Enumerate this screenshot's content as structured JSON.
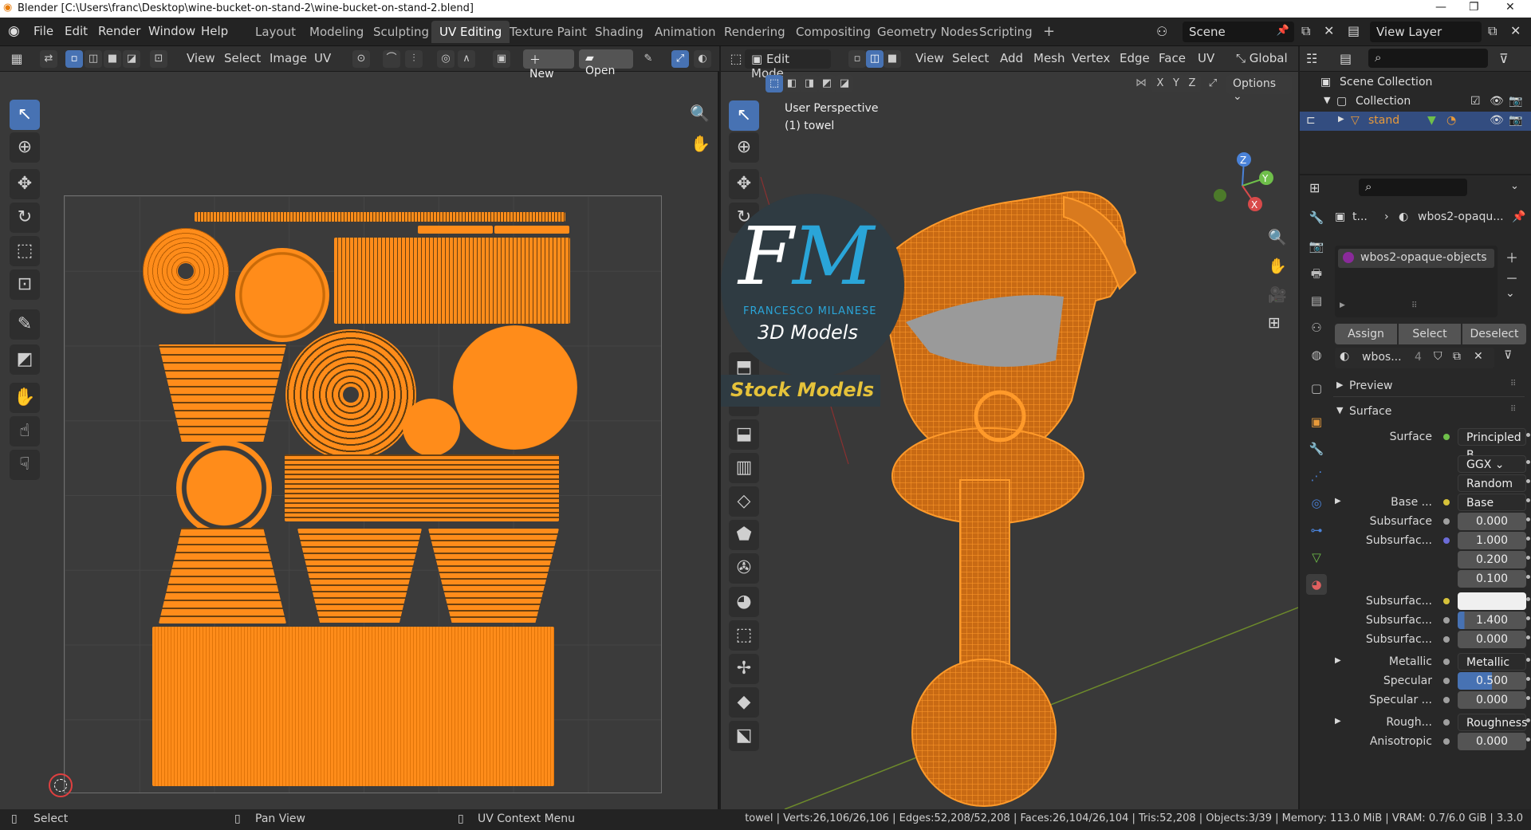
{
  "window": {
    "title": "Blender [C:\\Users\\franc\\Desktop\\wine-bucket-on-stand-2\\wine-bucket-on-stand-2.blend]",
    "minimize": "—",
    "maximize": "❐",
    "close": "✕"
  },
  "menus": [
    "File",
    "Edit",
    "Render",
    "Window",
    "Help"
  ],
  "workspaces": [
    {
      "label": "Layout"
    },
    {
      "label": "Modeling"
    },
    {
      "label": "Sculpting"
    },
    {
      "label": "UV Editing",
      "active": true
    },
    {
      "label": "Texture Paint"
    },
    {
      "label": "Shading"
    },
    {
      "label": "Animation"
    },
    {
      "label": "Rendering"
    },
    {
      "label": "Compositing"
    },
    {
      "label": "Geometry Nodes"
    },
    {
      "label": "Scripting"
    }
  ],
  "add_workspace": "+",
  "scene": {
    "value": "Scene"
  },
  "view_layer": {
    "value": "View Layer"
  },
  "uv_header": {
    "view": "View",
    "select": "Select",
    "image": "Image",
    "uv": "UV",
    "new": "New",
    "open": "Open"
  },
  "viewport_header": {
    "mode": "Edit Mode",
    "view": "View",
    "select": "Select",
    "add": "Add",
    "mesh": "Mesh",
    "vertex": "Vertex",
    "edge": "Edge",
    "face": "Face",
    "uv": "UV",
    "orientation": "Global",
    "options": "Options",
    "x": "X",
    "y": "Y",
    "z": "Z"
  },
  "viewport_overlay": {
    "perspective": "User Perspective",
    "object": "(1) towel"
  },
  "watermark": {
    "letters_f": "F",
    "letters_m": "M",
    "name": "FRANCESCO MILANESE",
    "sub": "3D Models",
    "banner": "Stock Models"
  },
  "gizmo": {
    "x": "X",
    "y": "Y",
    "z": "Z"
  },
  "outliner": {
    "search_placeholder": "",
    "root": "Scene Collection",
    "collection": "Collection",
    "object": "stand"
  },
  "properties": {
    "breadcrumb_obj": "t...",
    "breadcrumb_mat": "wbos2-opaqu...",
    "slot": "wbos2-opaque-objects",
    "assign": "Assign",
    "select": "Select",
    "deselect": "Deselect",
    "material_name": "wbos...",
    "users": "4",
    "preview": "Preview",
    "surface_panel": "Surface",
    "rows": [
      {
        "label": "Surface",
        "value": "Principled B...",
        "dot": "#6fbf4a",
        "style": "dark"
      },
      {
        "label": "",
        "value": "GGX",
        "style": "dark",
        "dropdown": true
      },
      {
        "label": "",
        "value": "Random Walk",
        "style": "dark",
        "dropdown": true
      },
      {
        "label": "Base ...",
        "value": "Base Color",
        "dot": "#d6c23a",
        "style": "dark",
        "expand": true
      },
      {
        "label": "Subsurface",
        "value": "0.000",
        "dot": "#a0a0a0"
      },
      {
        "label": "Subsurfac...",
        "value": "1.000",
        "dot": "#6c6cd8"
      },
      {
        "label": "",
        "value": "0.200"
      },
      {
        "label": "",
        "value": "0.100"
      },
      {
        "label": "Subsurfac...",
        "value": "",
        "dot": "#d6c23a",
        "style": "white"
      },
      {
        "label": "Subsurfac...",
        "value": "1.400",
        "dot": "#a0a0a0",
        "fill": 0.1
      },
      {
        "label": "Subsurfac...",
        "value": "0.000",
        "dot": "#a0a0a0"
      },
      {
        "label": "Metallic",
        "value": "Metallic",
        "dot": "#a0a0a0",
        "style": "dark",
        "expand": true
      },
      {
        "label": "Specular",
        "value": "0.500",
        "dot": "#a0a0a0",
        "fill": 0.5
      },
      {
        "label": "Specular ...",
        "value": "0.000",
        "dot": "#a0a0a0"
      },
      {
        "label": "Rough...",
        "value": "Roughness",
        "dot": "#a0a0a0",
        "style": "dark",
        "expand": true
      },
      {
        "label": "Anisotropic",
        "value": "0.000",
        "dot": "#a0a0a0"
      }
    ]
  },
  "status": {
    "select": "Select",
    "pan": "Pan View",
    "context": "UV Context Menu",
    "stats": "towel | Verts:26,106/26,106 | Edges:52,208/52,208 | Faces:26,104/26,104 | Tris:52,208 | Objects:3/39 | Memory: 113.0 MiB | VRAM: 0.7/6.0 GiB | 3.3.0"
  },
  "colors": {
    "accent": "#4772b3",
    "uv_orange": "#ff8c1a",
    "active_tab": "#3d3d3d"
  }
}
